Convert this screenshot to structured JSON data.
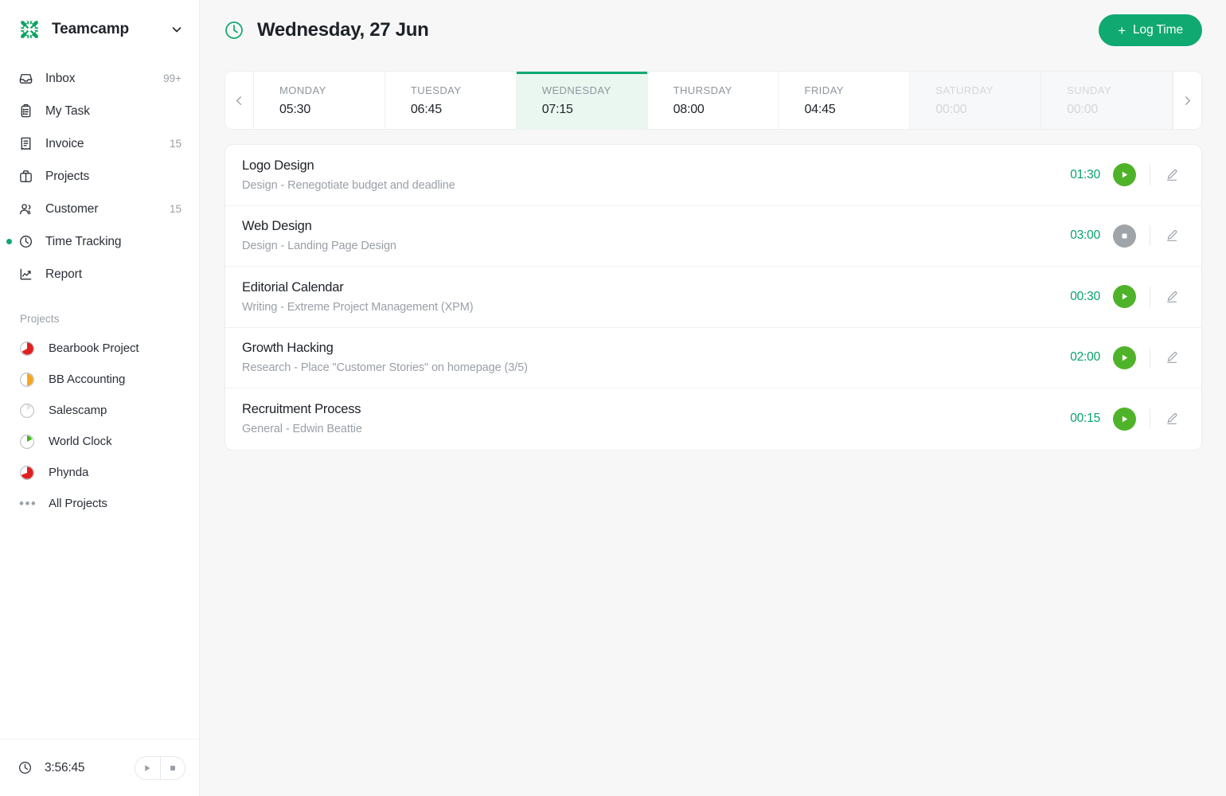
{
  "sidebar": {
    "brand": {
      "name": "Teamcamp",
      "logo_icon": "teamcamp-logo",
      "caret_icon": "chevron-down-icon"
    },
    "nav": [
      {
        "label": "Inbox",
        "badge": "99+",
        "icon": "inbox-icon",
        "active": false
      },
      {
        "label": "My Task",
        "badge": "",
        "icon": "clipboard-icon",
        "active": false
      },
      {
        "label": "Invoice",
        "badge": "15",
        "icon": "invoice-icon",
        "active": false
      },
      {
        "label": "Projects",
        "badge": "",
        "icon": "briefcase-icon",
        "active": false
      },
      {
        "label": "Customer",
        "badge": "15",
        "icon": "users-icon",
        "active": false
      },
      {
        "label": "Time Tracking",
        "badge": "",
        "icon": "clock-icon",
        "active": true
      },
      {
        "label": "Report",
        "badge": "",
        "icon": "chart-line-icon",
        "active": false
      }
    ],
    "projects_section_title": "Projects",
    "projects": [
      {
        "label": "Bearbook Project",
        "icon": "pie-progress-icon",
        "color": "#e02020",
        "progress": 60
      },
      {
        "label": "BB Accounting",
        "icon": "pie-progress-icon",
        "color": "#f5a623",
        "progress": 50
      },
      {
        "label": "Salescamp",
        "icon": "pie-progress-icon",
        "color": "#e9ebed",
        "progress": 18
      },
      {
        "label": "World Clock",
        "icon": "pie-progress-icon",
        "color": "#3fb618",
        "progress": 22
      },
      {
        "label": "Phynda",
        "icon": "pie-progress-icon",
        "color": "#e02020",
        "progress": 62
      }
    ],
    "all_projects": {
      "label": "All Projects",
      "icon": "ellipsis-icon"
    },
    "footer": {
      "clock_icon": "clock-icon",
      "total_time": "3:56:45",
      "play_icon": "play-icon",
      "stop_icon": "stop-icon"
    }
  },
  "header": {
    "clock_icon": "clock-icon",
    "title": "Wednesday, 27 Jun",
    "log_time_label": "Log Time",
    "log_time_plus": "+"
  },
  "week": {
    "prev_icon": "chevron-left-icon",
    "next_icon": "chevron-right-icon",
    "days": [
      {
        "name": "MONDAY",
        "time": "05:30",
        "state": "normal"
      },
      {
        "name": "TUESDAY",
        "time": "06:45",
        "state": "normal"
      },
      {
        "name": "WEDNESDAY",
        "time": "07:15",
        "state": "active"
      },
      {
        "name": "THURSDAY",
        "time": "08:00",
        "state": "normal"
      },
      {
        "name": "FRIDAY",
        "time": "04:45",
        "state": "normal"
      },
      {
        "name": "SATURDAY",
        "time": "00:00",
        "state": "disabled"
      },
      {
        "name": "SUNDAY",
        "time": "00:00",
        "state": "disabled"
      }
    ]
  },
  "tasks": [
    {
      "title": "Logo Design",
      "subtitle": "Design - Renegotiate budget and deadline",
      "duration": "01:30",
      "state": "play",
      "edit_icon": "pencil-icon"
    },
    {
      "title": "Web Design",
      "subtitle": "Design - Landing Page Design",
      "duration": "03:00",
      "state": "stop",
      "edit_icon": "pencil-icon"
    },
    {
      "title": "Editorial Calendar",
      "subtitle": "Writing - Extreme Project Management (XPM)",
      "duration": "00:30",
      "state": "play",
      "edit_icon": "pencil-icon"
    },
    {
      "title": "Growth Hacking",
      "subtitle": "Research - Place \"Customer Stories\" on homepage (3/5)",
      "duration": "02:00",
      "state": "play",
      "edit_icon": "pencil-icon"
    },
    {
      "title": "Recruitment Process",
      "subtitle": "General - Edwin Beattie",
      "duration": "00:15",
      "state": "play",
      "edit_icon": "pencil-icon"
    }
  ],
  "colors": {
    "brand_green": "#0fa971",
    "play_green": "#4fb32a",
    "stop_gray": "#9fa4a9",
    "duration_green": "#08a26b",
    "page_bg": "#f7f7f7"
  }
}
